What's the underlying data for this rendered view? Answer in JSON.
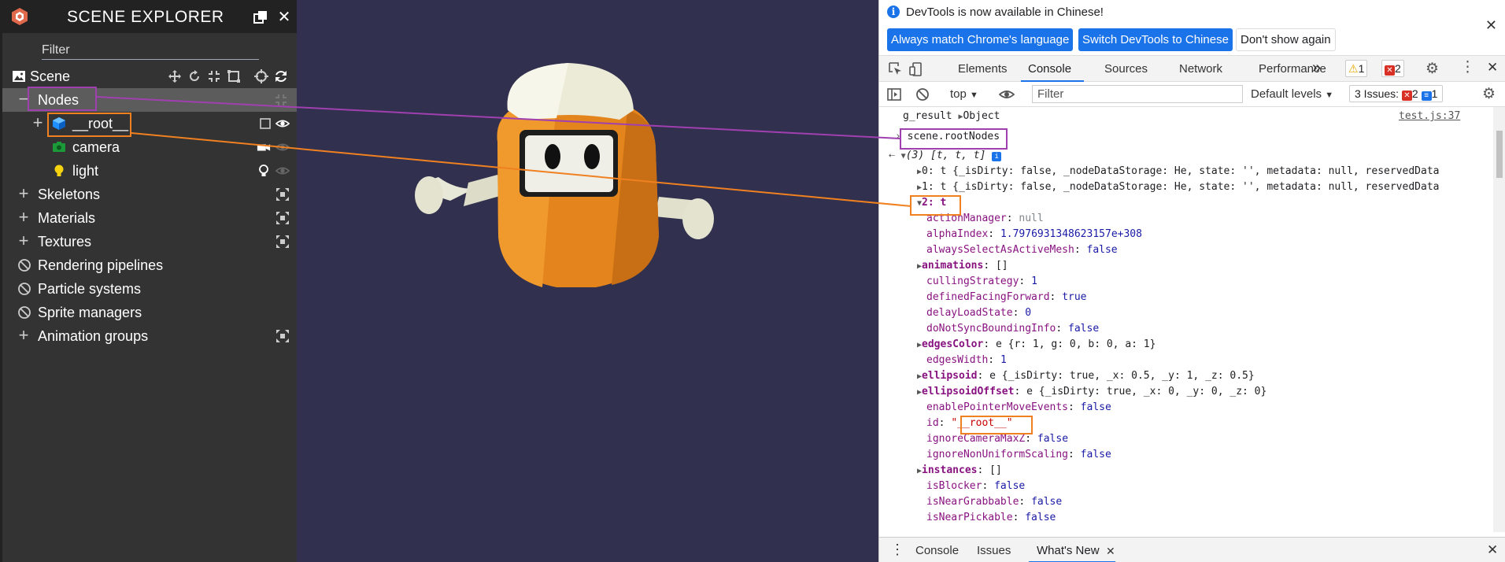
{
  "explorer": {
    "title": "SCENE EXPLORER",
    "filter_placeholder": "Filter",
    "scene_label": "Scene",
    "tree": {
      "nodes": "Nodes",
      "root": "__root__",
      "camera": "camera",
      "light": "light",
      "skeletons": "Skeletons",
      "materials": "Materials",
      "textures": "Textures",
      "rendering_pipelines": "Rendering pipelines",
      "particle_systems": "Particle systems",
      "sprite_managers": "Sprite managers",
      "animation_groups": "Animation groups"
    }
  },
  "devtools": {
    "info_message": "DevTools is now available in Chinese!",
    "btn_match": "Always match Chrome's language",
    "btn_switch": "Switch DevTools to Chinese",
    "btn_dont_show": "Don't show again",
    "tabs": [
      "Elements",
      "Console",
      "Sources",
      "Network",
      "Performance"
    ],
    "more_tabs": "»",
    "warnings_count": "1",
    "errors_count": "2",
    "context": "top",
    "filter_placeholder": "Filter",
    "levels": "Default levels",
    "issues_label": "3 Issues:",
    "issues_errors": "2",
    "issues_info": "1",
    "drawer_tabs": [
      "Console",
      "Issues",
      "What's New"
    ],
    "console": {
      "g_result": "g_result",
      "g_result_type": "Object",
      "source_link": "test.js:37",
      "command": "scene.rootNodes",
      "array_summary": "(3) [t, t, t]",
      "item0": "0: t {_isDirty: false, _nodeDataStorage: He, state: '', metadata: null, reservedData",
      "item1": "1: t {_isDirty: false, _nodeDataStorage: He, state: '', metadata: null, reservedData",
      "item2": "2: t",
      "props": [
        {
          "k": "actionManager",
          "v": "null",
          "t": "null"
        },
        {
          "k": "alphaIndex",
          "v": "1.7976931348623157e+308",
          "t": "num"
        },
        {
          "k": "alwaysSelectAsActiveMesh",
          "v": "false",
          "t": "kw"
        },
        {
          "k": "animations",
          "v": "[]",
          "t": "plain",
          "exp": true
        },
        {
          "k": "cullingStrategy",
          "v": "1",
          "t": "num"
        },
        {
          "k": "definedFacingForward",
          "v": "true",
          "t": "kw"
        },
        {
          "k": "delayLoadState",
          "v": "0",
          "t": "num"
        },
        {
          "k": "doNotSyncBoundingInfo",
          "v": "false",
          "t": "kw"
        },
        {
          "k": "edgesColor",
          "v": "e {r: 1, g: 0, b: 0, a: 1}",
          "t": "plain",
          "exp": true
        },
        {
          "k": "edgesWidth",
          "v": "1",
          "t": "num"
        },
        {
          "k": "ellipsoid",
          "v": "e {_isDirty: true, _x: 0.5, _y: 1, _z: 0.5}",
          "t": "plain",
          "exp": true
        },
        {
          "k": "ellipsoidOffset",
          "v": "e {_isDirty: true, _x: 0, _y: 0, _z: 0}",
          "t": "plain",
          "exp": true
        },
        {
          "k": "enablePointerMoveEvents",
          "v": "false",
          "t": "kw"
        },
        {
          "k": "id",
          "v": "\"__root__\"",
          "t": "str"
        },
        {
          "k": "ignoreCameraMaxZ",
          "v": "false",
          "t": "kw"
        },
        {
          "k": "ignoreNonUniformScaling",
          "v": "false",
          "t": "kw"
        },
        {
          "k": "instances",
          "v": "[]",
          "t": "plain",
          "exp": true
        },
        {
          "k": "isBlocker",
          "v": "false",
          "t": "kw"
        },
        {
          "k": "isNearGrabbable",
          "v": "false",
          "t": "kw"
        },
        {
          "k": "isNearPickable",
          "v": "false",
          "t": "kw"
        }
      ]
    }
  },
  "colors": {
    "explorer_bg": "#333333",
    "viewport_bg": "#31304e",
    "accent_blue": "#1a73e8",
    "highlight_purple": "#a040b0",
    "highlight_orange": "#f08020"
  }
}
